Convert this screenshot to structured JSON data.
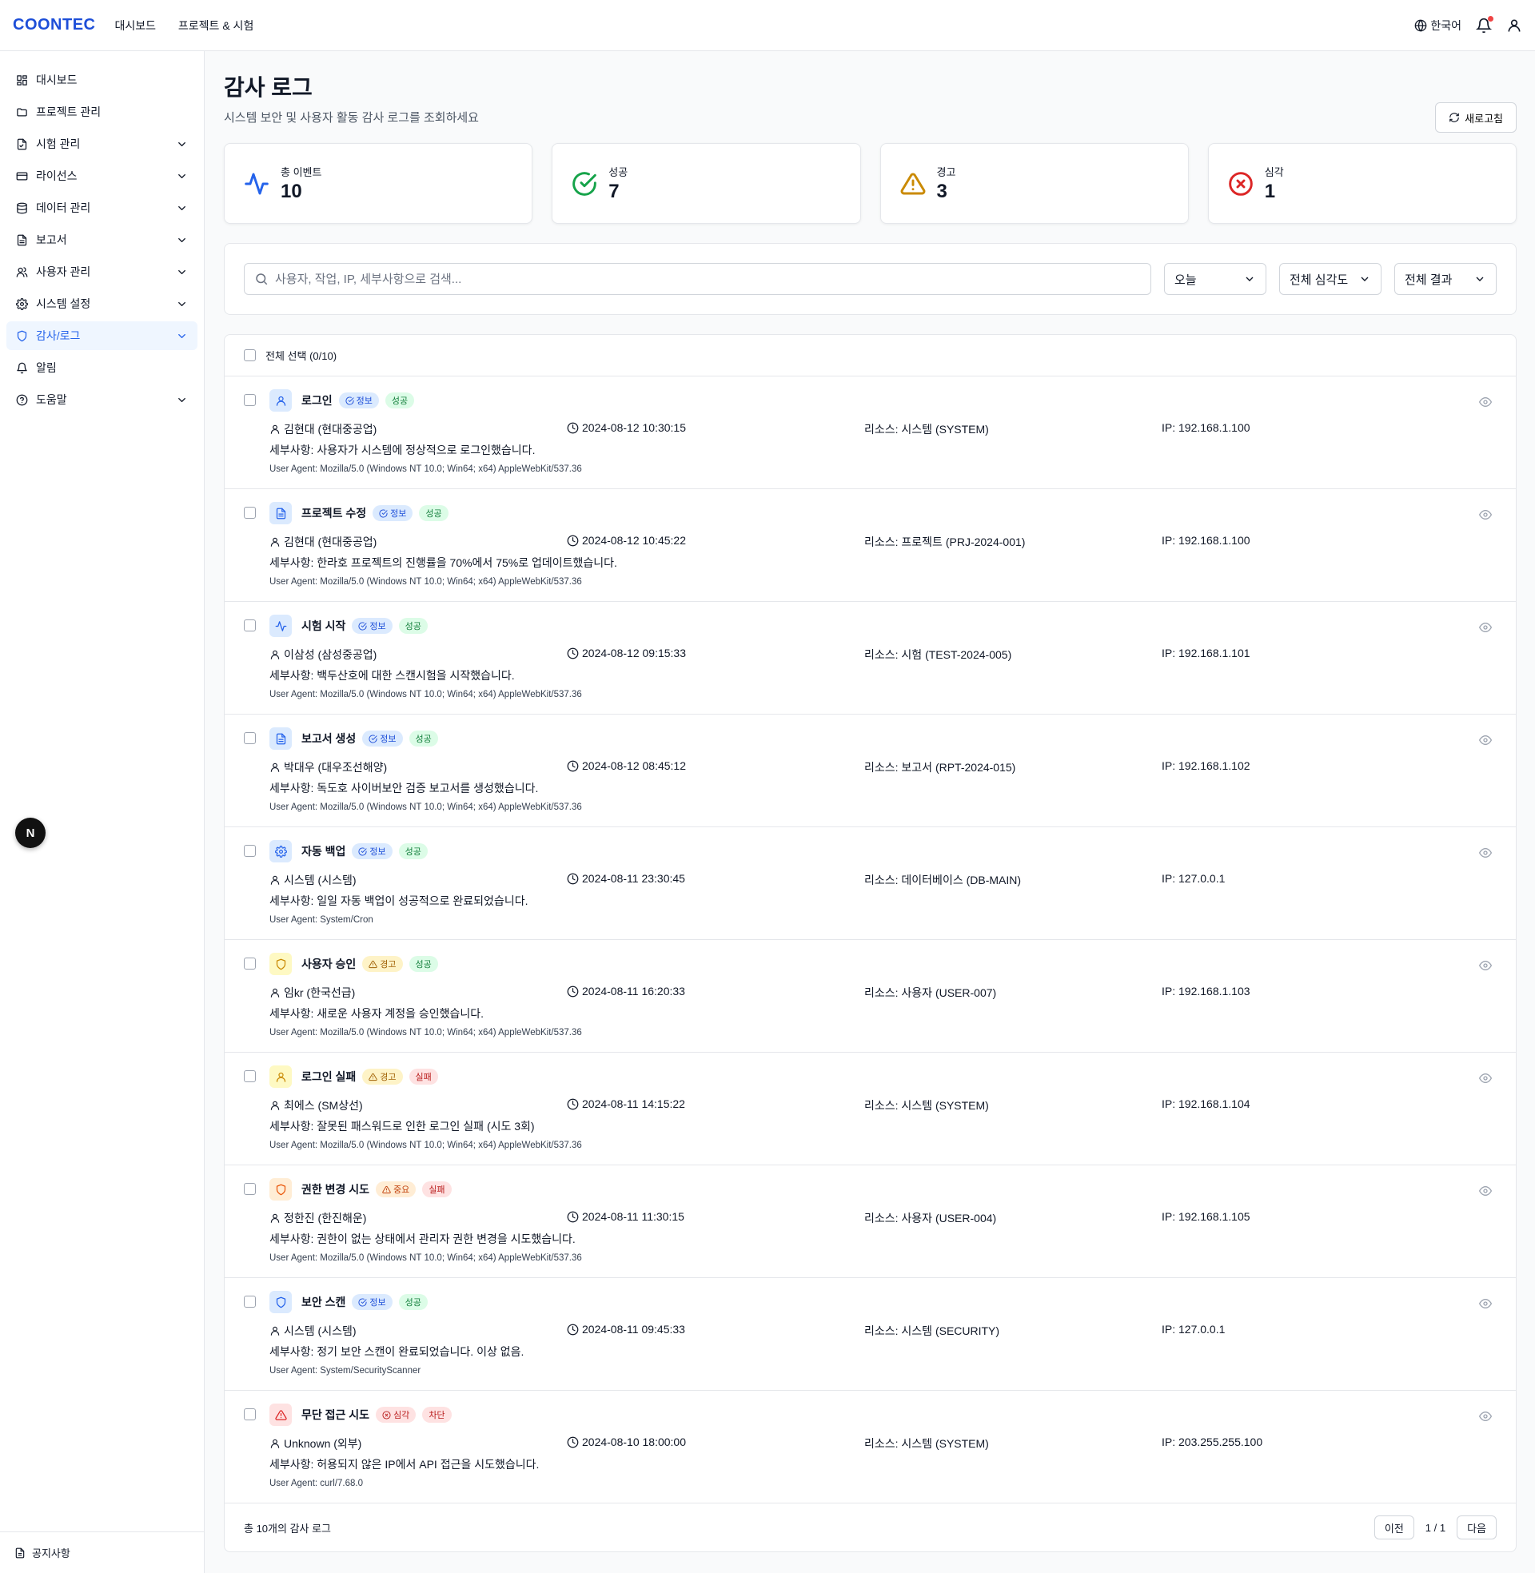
{
  "header": {
    "logo": "COONTEC",
    "nav": [
      "대시보드",
      "프로젝트 & 시험"
    ],
    "language": "한국어"
  },
  "sidebar": {
    "items": [
      {
        "label": "대시보드",
        "icon": "grid-icon",
        "chevron": false,
        "active": false
      },
      {
        "label": "프로젝트 관리",
        "icon": "folder-icon",
        "chevron": false,
        "active": false
      },
      {
        "label": "시험 관리",
        "icon": "test-file-icon",
        "chevron": true,
        "active": false
      },
      {
        "label": "라이선스",
        "icon": "card-icon",
        "chevron": true,
        "active": false
      },
      {
        "label": "데이터 관리",
        "icon": "database-icon",
        "chevron": true,
        "active": false
      },
      {
        "label": "보고서",
        "icon": "file-text-icon",
        "chevron": true,
        "active": false
      },
      {
        "label": "사용자 관리",
        "icon": "users-icon",
        "chevron": true,
        "active": false
      },
      {
        "label": "시스템 설정",
        "icon": "gear-icon",
        "chevron": true,
        "active": false
      },
      {
        "label": "감사/로그",
        "icon": "shield-icon",
        "chevron": true,
        "active": true
      },
      {
        "label": "알림",
        "icon": "bell-icon",
        "chevron": false,
        "active": false
      },
      {
        "label": "도움말",
        "icon": "help-icon",
        "chevron": true,
        "active": false
      }
    ],
    "footer": "공지사항",
    "floating_badge": "N"
  },
  "page": {
    "title": "감사 로그",
    "subtitle": "시스템 보안 및 사용자 활동 감사 로그를 조회하세요",
    "refresh_label": "새로고침"
  },
  "stats": [
    {
      "label": "총 이벤트",
      "value": "10",
      "icon": "activity-icon",
      "color": "#2563eb"
    },
    {
      "label": "성공",
      "value": "7",
      "icon": "check-circle-icon",
      "color": "#16a34a"
    },
    {
      "label": "경고",
      "value": "3",
      "icon": "alert-triangle-icon",
      "color": "#ca8a04"
    },
    {
      "label": "심각",
      "value": "1",
      "icon": "x-circle-icon",
      "color": "#dc2626"
    }
  ],
  "filters": {
    "search_placeholder": "사용자, 작업, IP, 세부사항으로 검색...",
    "date": "오늘",
    "severity": "전체 심각도",
    "result": "전체 결과"
  },
  "list": {
    "select_all": "전체 선택 (0/10)",
    "total": "총 10개의 감사 로그",
    "prev": "이전",
    "page": "1 / 1",
    "next": "다음"
  },
  "logs": [
    {
      "action": "로그인",
      "icon": "user-icon",
      "tone": "info",
      "severity": "정보",
      "result": "성공",
      "user": "김현대 (현대중공업)",
      "time": "2024-08-12 10:30:15",
      "resource": "리소스: 시스템 (SYSTEM)",
      "ip": "IP: 192.168.1.100",
      "detail": "세부사항: 사용자가 시스템에 정상적으로 로그인했습니다.",
      "agent": "User Agent: Mozilla/5.0 (Windows NT 10.0; Win64; x64) AppleWebKit/537.36"
    },
    {
      "action": "프로젝트 수정",
      "icon": "file-text-icon",
      "tone": "info",
      "severity": "정보",
      "result": "성공",
      "user": "김현대 (현대중공업)",
      "time": "2024-08-12 10:45:22",
      "resource": "리소스: 프로젝트 (PRJ-2024-001)",
      "ip": "IP: 192.168.1.100",
      "detail": "세부사항: 한라호 프로젝트의 진행률을 70%에서 75%로 업데이트했습니다.",
      "agent": "User Agent: Mozilla/5.0 (Windows NT 10.0; Win64; x64) AppleWebKit/537.36"
    },
    {
      "action": "시험 시작",
      "icon": "activity-icon",
      "tone": "info",
      "severity": "정보",
      "result": "성공",
      "user": "이삼성 (삼성중공업)",
      "time": "2024-08-12 09:15:33",
      "resource": "리소스: 시험 (TEST-2024-005)",
      "ip": "IP: 192.168.1.101",
      "detail": "세부사항: 백두산호에 대한 스캔시험을 시작했습니다.",
      "agent": "User Agent: Mozilla/5.0 (Windows NT 10.0; Win64; x64) AppleWebKit/537.36"
    },
    {
      "action": "보고서 생성",
      "icon": "file-text-icon",
      "tone": "info",
      "severity": "정보",
      "result": "성공",
      "user": "박대우 (대우조선해양)",
      "time": "2024-08-12 08:45:12",
      "resource": "리소스: 보고서 (RPT-2024-015)",
      "ip": "IP: 192.168.1.102",
      "detail": "세부사항: 독도호 사이버보안 검증 보고서를 생성했습니다.",
      "agent": "User Agent: Mozilla/5.0 (Windows NT 10.0; Win64; x64) AppleWebKit/537.36"
    },
    {
      "action": "자동 백업",
      "icon": "gear-icon",
      "tone": "info",
      "severity": "정보",
      "result": "성공",
      "user": "시스템 (시스템)",
      "time": "2024-08-11 23:30:45",
      "resource": "리소스: 데이터베이스 (DB-MAIN)",
      "ip": "IP: 127.0.0.1",
      "detail": "세부사항: 일일 자동 백업이 성공적으로 완료되었습니다.",
      "agent": "User Agent: System/Cron"
    },
    {
      "action": "사용자 승인",
      "icon": "shield-icon",
      "tone": "warn",
      "severity": "경고",
      "result": "성공",
      "user": "임kr (한국선급)",
      "time": "2024-08-11 16:20:33",
      "resource": "리소스: 사용자 (USER-007)",
      "ip": "IP: 192.168.1.103",
      "detail": "세부사항: 새로운 사용자 계정을 승인했습니다.",
      "agent": "User Agent: Mozilla/5.0 (Windows NT 10.0; Win64; x64) AppleWebKit/537.36"
    },
    {
      "action": "로그인 실패",
      "icon": "user-icon",
      "tone": "warn",
      "severity": "경고",
      "result": "실패",
      "user": "최에스 (SM상선)",
      "time": "2024-08-11 14:15:22",
      "resource": "리소스: 시스템 (SYSTEM)",
      "ip": "IP: 192.168.1.104",
      "detail": "세부사항: 잘못된 패스워드로 인한 로그인 실패 (시도 3회)",
      "agent": "User Agent: Mozilla/5.0 (Windows NT 10.0; Win64; x64) AppleWebKit/537.36"
    },
    {
      "action": "권한 변경 시도",
      "icon": "shield-icon",
      "tone": "major",
      "severity": "중요",
      "result": "실패",
      "user": "정한진 (한진해운)",
      "time": "2024-08-11 11:30:15",
      "resource": "리소스: 사용자 (USER-004)",
      "ip": "IP: 192.168.1.105",
      "detail": "세부사항: 권한이 없는 상태에서 관리자 권한 변경을 시도했습니다.",
      "agent": "User Agent: Mozilla/5.0 (Windows NT 10.0; Win64; x64) AppleWebKit/537.36"
    },
    {
      "action": "보안 스캔",
      "icon": "shield-icon",
      "tone": "info",
      "severity": "정보",
      "result": "성공",
      "user": "시스템 (시스템)",
      "time": "2024-08-11 09:45:33",
      "resource": "리소스: 시스템 (SECURITY)",
      "ip": "IP: 127.0.0.1",
      "detail": "세부사항: 정기 보안 스캔이 완료되었습니다. 이상 없음.",
      "agent": "User Agent: System/SecurityScanner"
    },
    {
      "action": "무단 접근 시도",
      "icon": "alert-triangle-icon",
      "tone": "critical",
      "severity": "심각",
      "result": "차단",
      "user": "Unknown (외부)",
      "time": "2024-08-10 18:00:00",
      "resource": "리소스: 시스템 (SYSTEM)",
      "ip": "IP: 203.255.255.100",
      "detail": "세부사항: 허용되지 않은 IP에서 API 접근을 시도했습니다.",
      "agent": "User Agent: curl/7.68.0"
    }
  ],
  "tones": {
    "info": {
      "icon_bg": "#dbeafe",
      "icon_fg": "#2563eb",
      "badge_bg": "#dbeafe",
      "badge_fg": "#1d4ed8"
    },
    "warn": {
      "icon_bg": "#fef9c3",
      "icon_fg": "#ca8a04",
      "badge_bg": "#fef3c7",
      "badge_fg": "#a16207"
    },
    "major": {
      "icon_bg": "#ffedd5",
      "icon_fg": "#ea580c",
      "badge_bg": "#ffedd5",
      "badge_fg": "#c2410c"
    },
    "critical": {
      "icon_bg": "#fee2e2",
      "icon_fg": "#dc2626",
      "badge_bg": "#fee2e2",
      "badge_fg": "#b91c1c"
    }
  },
  "result_colors": {
    "성공": {
      "bg": "#dcfce7",
      "fg": "#15803d"
    },
    "실패": {
      "bg": "#fee2e2",
      "fg": "#b91c1c"
    },
    "차단": {
      "bg": "#fee2e2",
      "fg": "#b91c1c"
    }
  }
}
